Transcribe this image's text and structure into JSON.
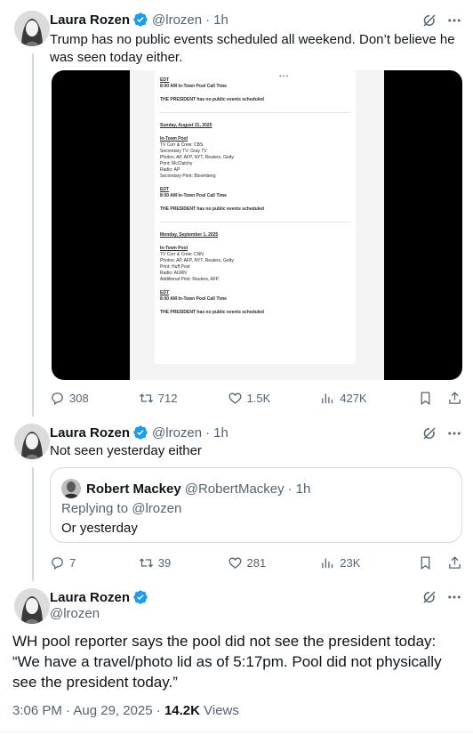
{
  "tweet1": {
    "name": "Laura Rozen",
    "handle": "@lrozen",
    "time": "1h",
    "text": "Trump has no public events scheduled all weekend. Don’t believe he was seen today either.",
    "media_doc": {
      "top": [
        {
          "t": "EDT",
          "s": "u"
        },
        {
          "t": "8:00 AM        In-Town Pool Call Time",
          "s": "b"
        },
        {
          "t": "THE PRESIDENT has no public events scheduled",
          "s": "b"
        }
      ],
      "day1": "Sunday, August 31, 2025",
      "pool1": [
        {
          "t": "In-Town Pool",
          "s": "u"
        },
        {
          "t": "TV Corr & Crew: CBS",
          "s": ""
        },
        {
          "t": "Secondary TV: Gray TV",
          "s": ""
        },
        {
          "t": "Photos: AP, AFP, NYT, Reuters, Getty",
          "s": ""
        },
        {
          "t": "Print: McClatchy",
          "s": ""
        },
        {
          "t": "Radio: AP",
          "s": ""
        },
        {
          "t": "Secondary Print: Bloomberg",
          "s": ""
        }
      ],
      "sched1": [
        {
          "t": "EDT",
          "s": "u"
        },
        {
          "t": "8:00 AM        In-Town Pool Call Time",
          "s": "b"
        },
        {
          "t": "THE PRESIDENT has no public events scheduled",
          "s": "b"
        }
      ],
      "day2": "Monday, September 1, 2025",
      "pool2": [
        {
          "t": "In-Town Pool",
          "s": "u"
        },
        {
          "t": "TV Corr & Crew: CNN",
          "s": ""
        },
        {
          "t": "Photos: AP, AFP, NYT, Reuters, Getty",
          "s": ""
        },
        {
          "t": "Print: Huff Post",
          "s": ""
        },
        {
          "t": "Radio: AURN",
          "s": ""
        },
        {
          "t": "Additional Print: Reuters, AFP",
          "s": ""
        }
      ],
      "sched2": [
        {
          "t": "EDT",
          "s": "u"
        },
        {
          "t": "8:00 AM        In-Town Pool Call Time",
          "s": "b"
        },
        {
          "t": "THE PRESIDENT has no public events scheduled",
          "s": "b"
        }
      ]
    },
    "stats": {
      "replies": "308",
      "reposts": "712",
      "likes": "1.5K",
      "views": "427K"
    }
  },
  "tweet2": {
    "name": "Laura Rozen",
    "handle": "@lrozen",
    "time": "1h",
    "text": "Not seen yesterday either",
    "quote": {
      "name": "Robert Mackey",
      "handle": "@RobertMackey",
      "time": "1h",
      "replying_to": "Replying to @lrozen",
      "text": "Or yesterday"
    },
    "stats": {
      "replies": "7",
      "reposts": "39",
      "likes": "281",
      "views": "23K"
    }
  },
  "tweet3": {
    "name": "Laura Rozen",
    "handle": "@lrozen",
    "text": "WH pool reporter says the pool did not see the president today: “We have a travel/photo lid as of 5:17pm. Pool did not physically see the president today.”",
    "timestamp": "3:06 PM · Aug 29, 2025 · ",
    "views_count": "14.2K",
    "views_label": " Views"
  },
  "colors": {
    "verified": "#1d9bf0",
    "secondary_text": "#536471",
    "border": "#cfd9de"
  }
}
